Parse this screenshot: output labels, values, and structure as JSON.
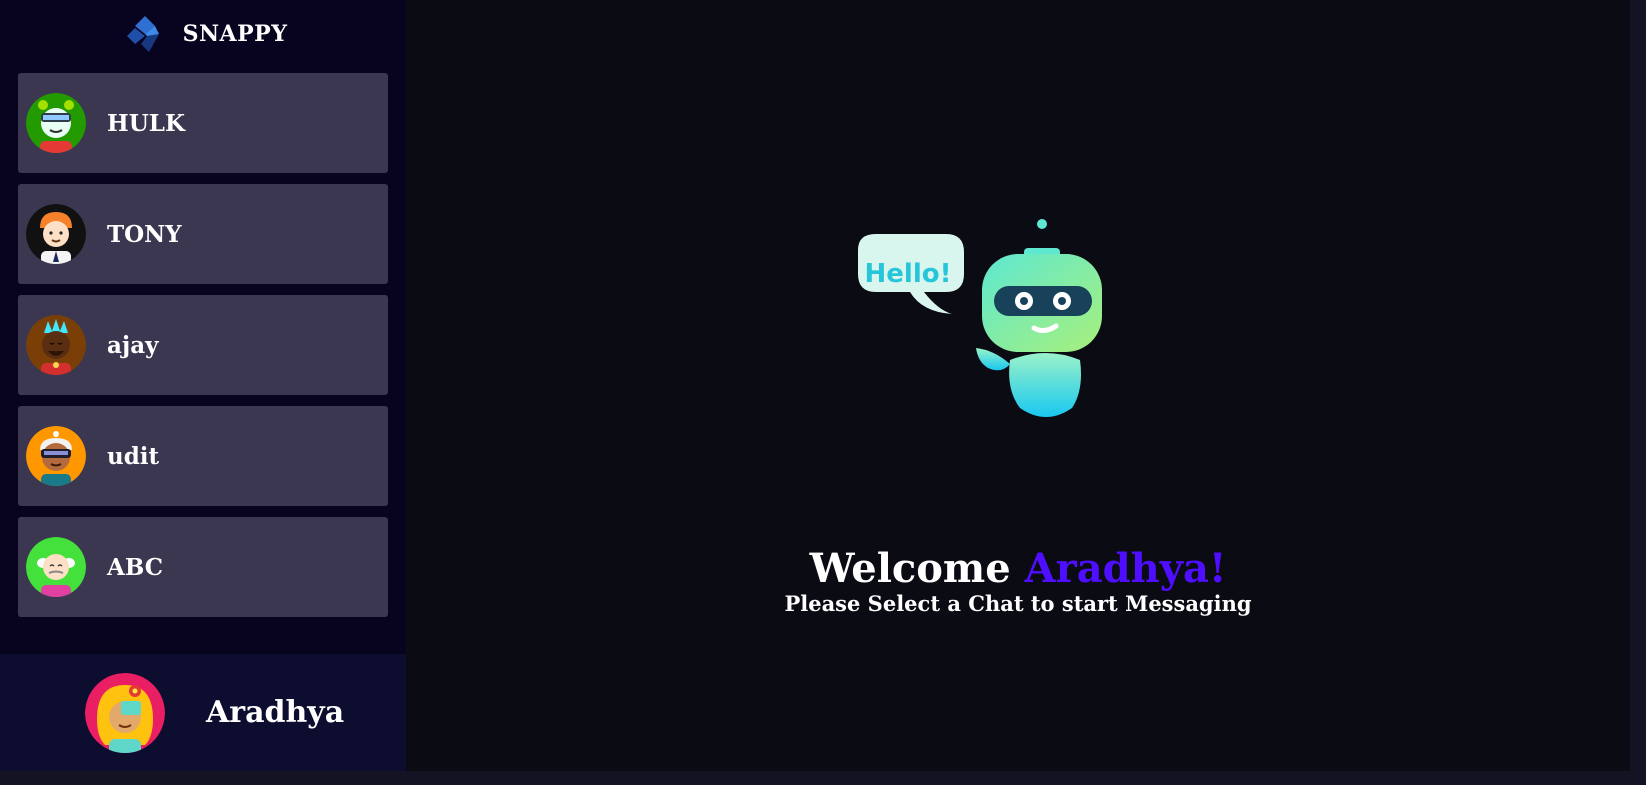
{
  "app": {
    "brand": "SNAPPY",
    "logo_icon": "snappy-logo-icon"
  },
  "contacts": [
    {
      "name": "HULK",
      "avatar": "avatar-hulk-icon",
      "bg": "#229a00"
    },
    {
      "name": "TONY",
      "avatar": "avatar-tony-icon",
      "bg": "#111111"
    },
    {
      "name": "ajay",
      "avatar": "avatar-ajay-icon",
      "bg": "#7a3f06"
    },
    {
      "name": "udit",
      "avatar": "avatar-udit-icon",
      "bg": "#ff9800"
    },
    {
      "name": "ABC",
      "avatar": "avatar-abc-icon",
      "bg": "#44e03c"
    }
  ],
  "current_user": {
    "name": "Aradhya",
    "avatar": "avatar-aradhya-icon",
    "bg": "#e91e63"
  },
  "welcome": {
    "greeting": "Welcome ",
    "name": "Aradhya!",
    "subtitle": "Please Select a Chat to start Messaging",
    "bubble_text": "Hello!",
    "illustration": "robot-hello-icon"
  },
  "colors": {
    "accent": "#4e0eff",
    "card": "#3b3750",
    "sidebar": "#080420",
    "main": "#0b0b14"
  }
}
